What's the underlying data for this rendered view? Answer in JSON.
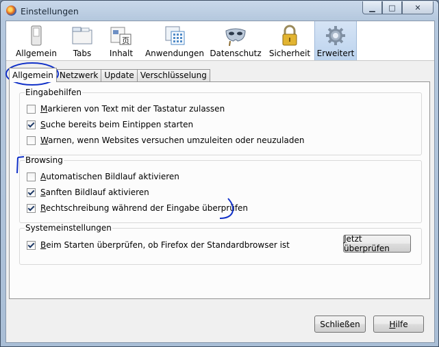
{
  "window": {
    "title": "Einstellungen"
  },
  "toolbar": {
    "items": [
      {
        "label": "Allgemein",
        "icon": "switch-icon"
      },
      {
        "label": "Tabs",
        "icon": "tabs-icon"
      },
      {
        "label": "Inhalt",
        "icon": "content-icon"
      },
      {
        "label": "Anwendungen",
        "icon": "applications-icon"
      },
      {
        "label": "Datenschutz",
        "icon": "mask-icon"
      },
      {
        "label": "Sicherheit",
        "icon": "padlock-icon"
      },
      {
        "label": "Erweitert",
        "icon": "gear-icon"
      }
    ],
    "selected": "Erweitert"
  },
  "tabs": [
    "Allgemein",
    "Netzwerk",
    "Update",
    "Verschlüsselung"
  ],
  "active_tab": "Allgemein",
  "groups": {
    "eingabehilfen": {
      "label": "Eingabehilfen",
      "options": [
        {
          "key": "M",
          "rest": "arkieren von Text mit der Tastatur zulassen",
          "checked": false
        },
        {
          "key": "S",
          "rest": "uche bereits beim Eintippen starten",
          "checked": true
        },
        {
          "key": "W",
          "rest": "arnen, wenn Websites versuchen umzuleiten oder neuzuladen",
          "checked": false
        }
      ]
    },
    "browsing": {
      "label": "Browsing",
      "options": [
        {
          "key": "A",
          "rest": "utomatischen Bildlauf aktivieren",
          "checked": false
        },
        {
          "key": "S",
          "rest": "anften Bildlauf aktivieren",
          "checked": true
        },
        {
          "key": "R",
          "rest": "echtschreibung während der Eingabe überprüfen",
          "checked": true
        }
      ]
    },
    "system": {
      "label": "Systemeinstellungen",
      "options": [
        {
          "key": "B",
          "rest": "eim Starten überprüfen, ob Firefox der Standardbrowser ist",
          "checked": true
        }
      ],
      "check_button": {
        "key": "J",
        "rest": "etzt überprüfen"
      }
    }
  },
  "footer": {
    "close_button": "Schließen",
    "help_key": "H",
    "help_rest": "ilfe"
  },
  "colors": {
    "selected_toolbar": "#bcd3ee",
    "annotation_ink": "#1030c8"
  }
}
